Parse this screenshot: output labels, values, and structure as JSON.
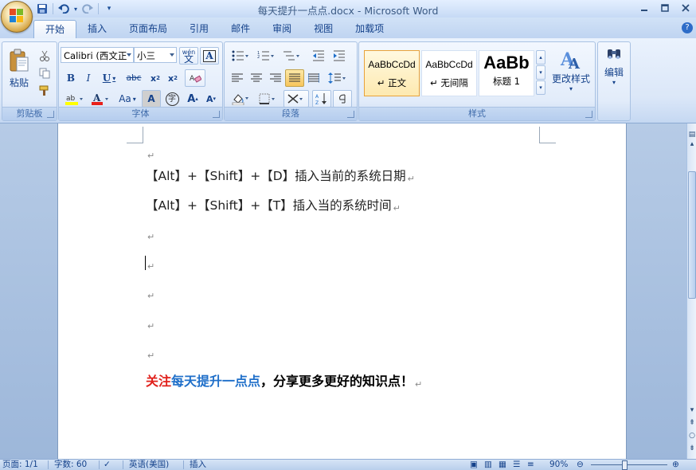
{
  "window": {
    "title": "每天提升一点点.docx - Microsoft Word",
    "minimize_icon": "minimize-icon",
    "maximize_icon": "maximize-icon",
    "close_icon": "close-icon"
  },
  "quick_access": [
    "save-icon",
    "undo-icon",
    "redo-icon",
    "customize-qat-icon"
  ],
  "tabs": [
    "开始",
    "插入",
    "页面布局",
    "引用",
    "邮件",
    "审阅",
    "视图",
    "加载项"
  ],
  "active_tab": "开始",
  "ribbon": {
    "clipboard": {
      "paste_label": "粘贴",
      "group_label": "剪贴板"
    },
    "font": {
      "font_name": "Calibri (西文正",
      "font_size": "小三",
      "wen_label": "wén",
      "group_label": "字体"
    },
    "paragraph": {
      "group_label": "段落"
    },
    "styles": {
      "items": [
        {
          "sample": "AaBbCcDd",
          "name": "↵ 正文"
        },
        {
          "sample": "AaBbCcDd",
          "name": "↵ 无间隔"
        },
        {
          "sample": "AaBb",
          "name": "标题 1"
        }
      ],
      "change_styles_label": "更改样式",
      "group_label": "样式"
    },
    "editing": {
      "label": "编辑"
    }
  },
  "document": {
    "lines": [
      "【Alt】+【Shift】+【D】插入当前的系统日期",
      "【Alt】+【Shift】+【T】插入当的系统时间"
    ],
    "paragraph_mark": "↵",
    "promo": {
      "part1": "关注",
      "part2": "每天提升一点点",
      "part3": "，分享更多更好的知识点！"
    },
    "colors": {
      "red": "#e0201b",
      "blue": "#1f6fc9",
      "black": "#000000"
    }
  },
  "statusbar": {
    "page": "页面: 1/1",
    "words": "字数: 60",
    "language": "英语(美国)",
    "mode": "插入",
    "zoom": "90%"
  }
}
